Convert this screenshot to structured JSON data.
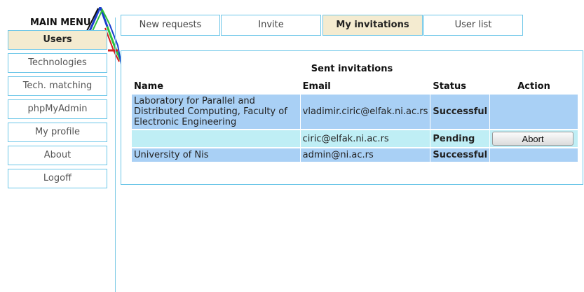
{
  "menu": {
    "title": "MAIN MENU",
    "items": [
      {
        "label": "Users",
        "active": true
      },
      {
        "label": "Technologies"
      },
      {
        "label": "Tech. matching"
      },
      {
        "label": "phpMyAdmin"
      },
      {
        "label": "My profile"
      },
      {
        "label": "About"
      },
      {
        "label": "Logoff"
      }
    ]
  },
  "tabs": [
    {
      "label": "New requests"
    },
    {
      "label": "Invite"
    },
    {
      "label": "My invitations",
      "active": true
    },
    {
      "label": "User list"
    }
  ],
  "panel": {
    "title": "Sent invitations",
    "columns": [
      "Name",
      "Email",
      "Status",
      "Action"
    ],
    "rows": [
      {
        "name": "Laboratory for Parallel and Distributed Computing, Faculty of Electronic Engineering",
        "email": "vladimir.ciric@elfak.ni.ac.rs",
        "status": "Successful",
        "action": ""
      },
      {
        "name": "",
        "email": "ciric@elfak.ni.ac.rs",
        "status": "Pending",
        "action": "Abort"
      },
      {
        "name": "University of Nis",
        "email": "admin@ni.ac.rs",
        "status": "Successful",
        "action": ""
      }
    ]
  },
  "colors": {
    "accent_border": "#6cc6e8",
    "active_tab_bg": "#f4ebd0",
    "row_blue": "#a9d0f5",
    "row_cyan": "#bfeef5",
    "status_successful": "#0b7a16",
    "status_pending": "#8b1a1a"
  },
  "icons": [
    "logo-graphic"
  ]
}
